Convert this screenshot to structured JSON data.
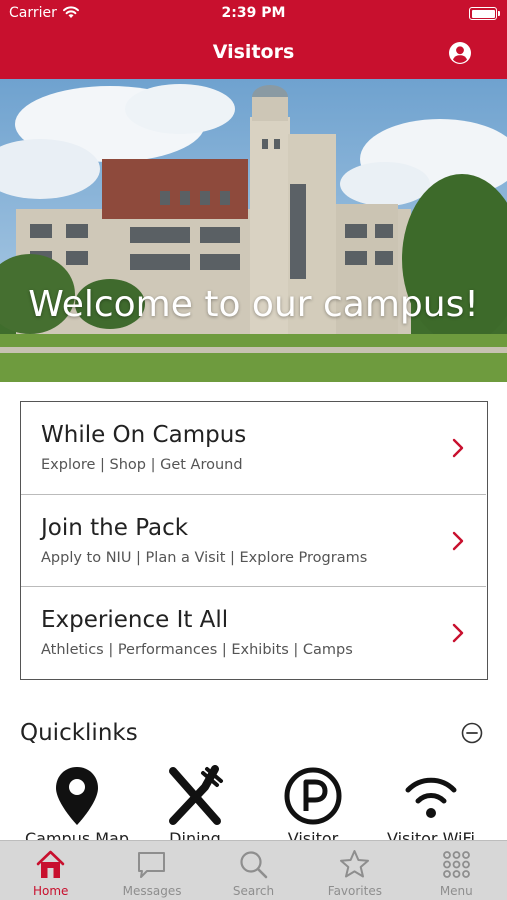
{
  "status_bar": {
    "carrier": "Carrier",
    "time": "2:39 PM"
  },
  "navbar": {
    "title": "Visitors"
  },
  "hero": {
    "welcome_text": "Welcome to our campus!"
  },
  "menu": {
    "items": [
      {
        "title": "While On Campus",
        "subtitle": "Explore | Shop | Get Around"
      },
      {
        "title": "Join the Pack",
        "subtitle": "Apply to NIU | Plan a Visit | Explore Programs"
      },
      {
        "title": "Experience It All",
        "subtitle": "Athletics | Performances | Exhibits | Camps"
      }
    ]
  },
  "quicklinks": {
    "heading": "Quicklinks",
    "items": [
      {
        "label": "Campus Map",
        "icon": "map-pin-icon"
      },
      {
        "label": "Dining",
        "icon": "fork-knife-icon"
      },
      {
        "label": "Visitor Parking",
        "icon": "parking-icon"
      },
      {
        "label": "Visitor WiFi",
        "icon": "wifi-icon"
      }
    ]
  },
  "tabbar": {
    "tabs": [
      {
        "label": "Home",
        "icon": "home-icon",
        "active": true
      },
      {
        "label": "Messages",
        "icon": "message-icon",
        "active": false
      },
      {
        "label": "Search",
        "icon": "search-icon",
        "active": false
      },
      {
        "label": "Favorites",
        "icon": "star-icon",
        "active": false
      },
      {
        "label": "Menu",
        "icon": "grid-icon",
        "active": false
      }
    ]
  },
  "colors": {
    "brand": "#c8102e",
    "tabbar_bg": "#d7d7d7",
    "inactive_tab": "#8e8e8e"
  }
}
